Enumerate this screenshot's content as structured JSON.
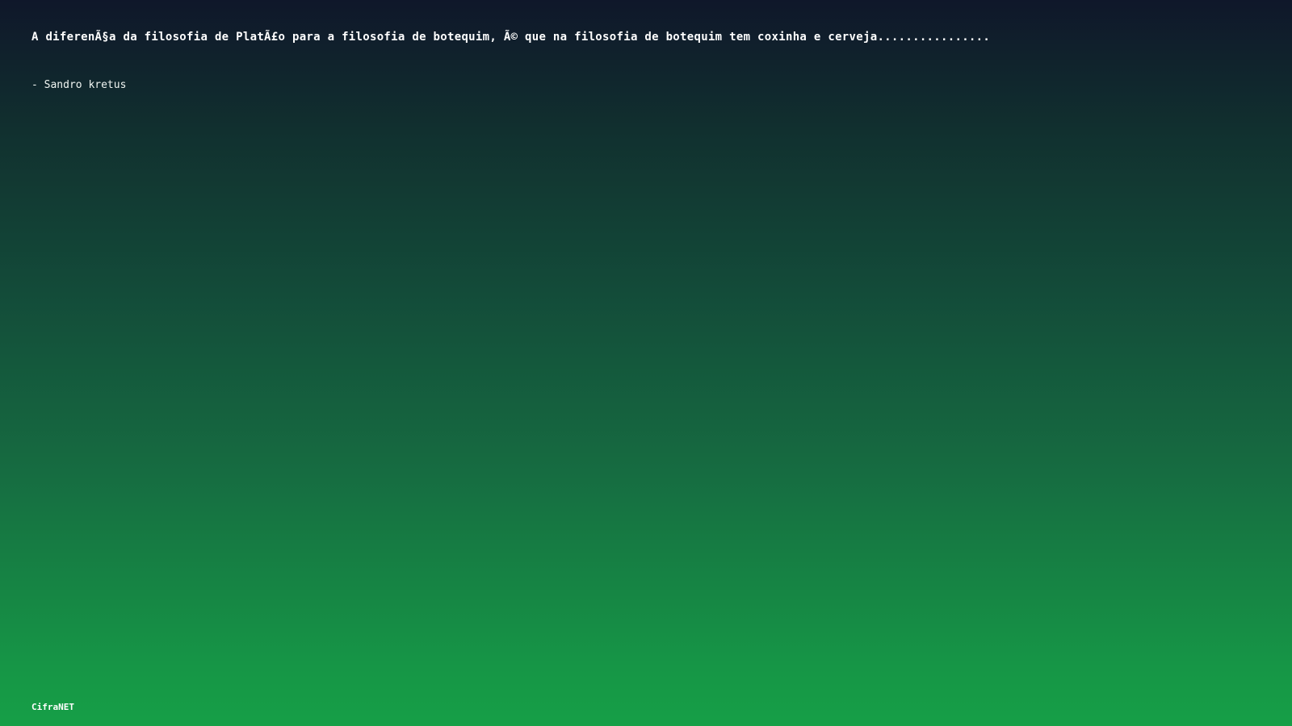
{
  "quote": {
    "text": "A diferenÃ§a da filosofia de PlatÃ£o para a filosofia de botequim, Ã© que na filosofia de botequim tem coxinha e cerveja................",
    "author": "- Sandro kretus"
  },
  "footer": {
    "brand": "CifraNET"
  },
  "colors": {
    "gradient_top": "#0f172a",
    "gradient_bottom": "#169f47",
    "text": "#ffffff"
  }
}
